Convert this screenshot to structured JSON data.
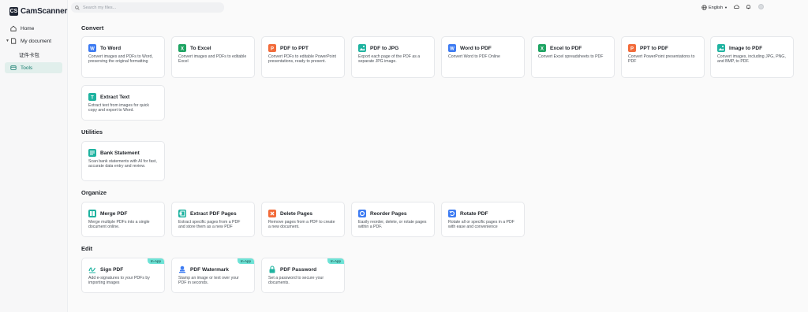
{
  "app": {
    "logo_mark": "CS",
    "name": "CamScanner"
  },
  "sidebar": {
    "home": "Home",
    "my_document": "My document",
    "sub_item": "证件卡包",
    "tools": "Tools"
  },
  "search": {
    "placeholder": "Search my files..."
  },
  "topbar": {
    "language": "English"
  },
  "sections": {
    "convert": "Convert",
    "utilities": "Utilities",
    "organize": "Organize",
    "edit": "Edit"
  },
  "cards": {
    "to_word": {
      "title": "To Word",
      "desc": "Convert images and PDFs to Word, preserving the original formatting"
    },
    "to_excel": {
      "title": "To Excel",
      "desc": "Convert images and PDFs to editable Excel"
    },
    "pdf_to_ppt": {
      "title": "PDF to PPT",
      "desc": "Convert PDFs to editable PowerPoint presentations, ready to present."
    },
    "pdf_to_jpg": {
      "title": "PDF to JPG",
      "desc": "Export each page of the PDF as a separate JPG image."
    },
    "word_to_pdf": {
      "title": "Word to PDF",
      "desc": "Convert Word to PDF Online"
    },
    "excel_to_pdf": {
      "title": "Excel to PDF",
      "desc": "Convert Excel spreadsheets to PDF"
    },
    "ppt_to_pdf": {
      "title": "PPT to PDF",
      "desc": "Convert PowerPoint presentations to PDF"
    },
    "image_to_pdf": {
      "title": "Image to PDF",
      "desc": "Convert images, including JPG, PNG, and BMP, to PDF."
    },
    "extract_text": {
      "title": "Extract Text",
      "desc": "Extract text from images for quick copy and export to Word."
    },
    "bank_statement": {
      "title": "Bank Statement",
      "desc": "Scan bank statements with AI for fast, accurate data entry and review."
    },
    "merge_pdf": {
      "title": "Merge PDF",
      "desc": "Merge multiple PDFs into a single document online."
    },
    "extract_pages": {
      "title": "Extract PDF Pages",
      "desc": "Extract specific pages from a PDF and store them as a new PDF"
    },
    "delete_pages": {
      "title": "Delete Pages",
      "desc": "Remove pages from a PDF to create a new document."
    },
    "reorder_pages": {
      "title": "Reorder Pages",
      "desc": "Easily reorder, delete, or rotate pages within a PDF."
    },
    "rotate_pdf": {
      "title": "Rotate PDF",
      "desc": "Rotate all or specific pages in a PDF with ease and convenience"
    },
    "sign_pdf": {
      "title": "Sign PDF",
      "desc": "Add e-signatures to your PDFs by importing images",
      "badge": "In-App"
    },
    "pdf_watermark": {
      "title": "PDF Watermark",
      "desc": "Stamp an image or text over your PDF in seconds.",
      "badge": "In-App"
    },
    "pdf_password": {
      "title": "PDF Password",
      "desc": "Set a password to secure your documents.",
      "badge": "In-App"
    }
  },
  "colors": {
    "accent": "#137a6c",
    "word_blue": "#3d7bf2",
    "excel_green": "#1fa463",
    "ppt_orange": "#f26b3a",
    "teal": "#1fb3a0",
    "badge": "#6ee3d6"
  }
}
